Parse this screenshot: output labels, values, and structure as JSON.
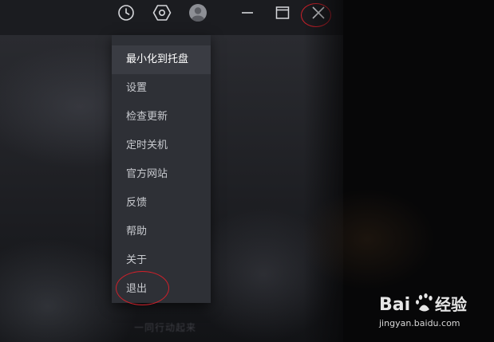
{
  "titlebar": {
    "icons": {
      "history": "clock-icon",
      "settings": "gear-hexagon-icon",
      "avatar": "user-avatar-icon",
      "minimize": "minimize-icon",
      "maximize": "maximize-icon",
      "close": "close-icon"
    }
  },
  "menu": {
    "items": [
      {
        "label": "最小化到托盘",
        "state": "hover"
      },
      {
        "label": "设置"
      },
      {
        "label": "检查更新"
      },
      {
        "label": "定时关机"
      },
      {
        "label": "官方网站"
      },
      {
        "label": "反馈"
      },
      {
        "label": "帮助"
      },
      {
        "label": "关于"
      },
      {
        "label": "退出"
      }
    ]
  },
  "background": {
    "ghost_text": "一同行动起来"
  },
  "watermark": {
    "brand": "Bai 经验",
    "url": "jingyan.baidu.com"
  },
  "colors": {
    "annotation_red": "#d0202a",
    "menu_bg": "#2e3036",
    "menu_hover_bg": "#3a3c43",
    "titlebar_bg": "#1b1c20"
  }
}
